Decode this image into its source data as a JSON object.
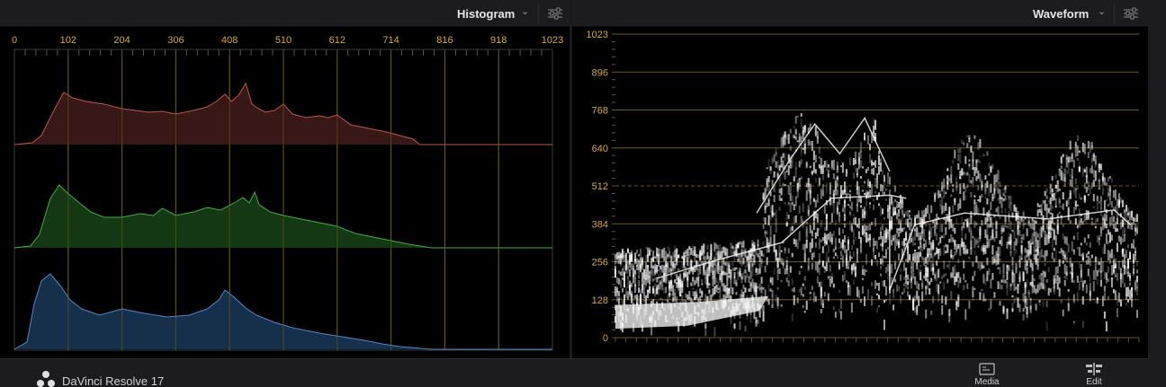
{
  "histogram": {
    "title": "Histogram",
    "ticks": [
      "0",
      "102",
      "204",
      "306",
      "408",
      "510",
      "612",
      "714",
      "816",
      "918",
      "1023"
    ],
    "channels": [
      {
        "name": "red",
        "stroke": "#c0534b",
        "fill": "#3a1918"
      },
      {
        "name": "green",
        "stroke": "#3fae3f",
        "fill": "#153a15"
      },
      {
        "name": "blue",
        "stroke": "#4f87c8",
        "fill": "#17314f"
      }
    ]
  },
  "waveform": {
    "title": "Waveform",
    "ticks": [
      "1023",
      "896",
      "768",
      "640",
      "512",
      "384",
      "256",
      "128",
      "0"
    ]
  },
  "footer": {
    "app_name": "DaVinci Resolve 17",
    "media_label": "Media",
    "edit_label": "Edit"
  },
  "colors": {
    "accent": "#d6a93a",
    "grid": "#6b5a1e",
    "panel_bg": "#000000",
    "header_bg": "#1c1c1e"
  }
}
